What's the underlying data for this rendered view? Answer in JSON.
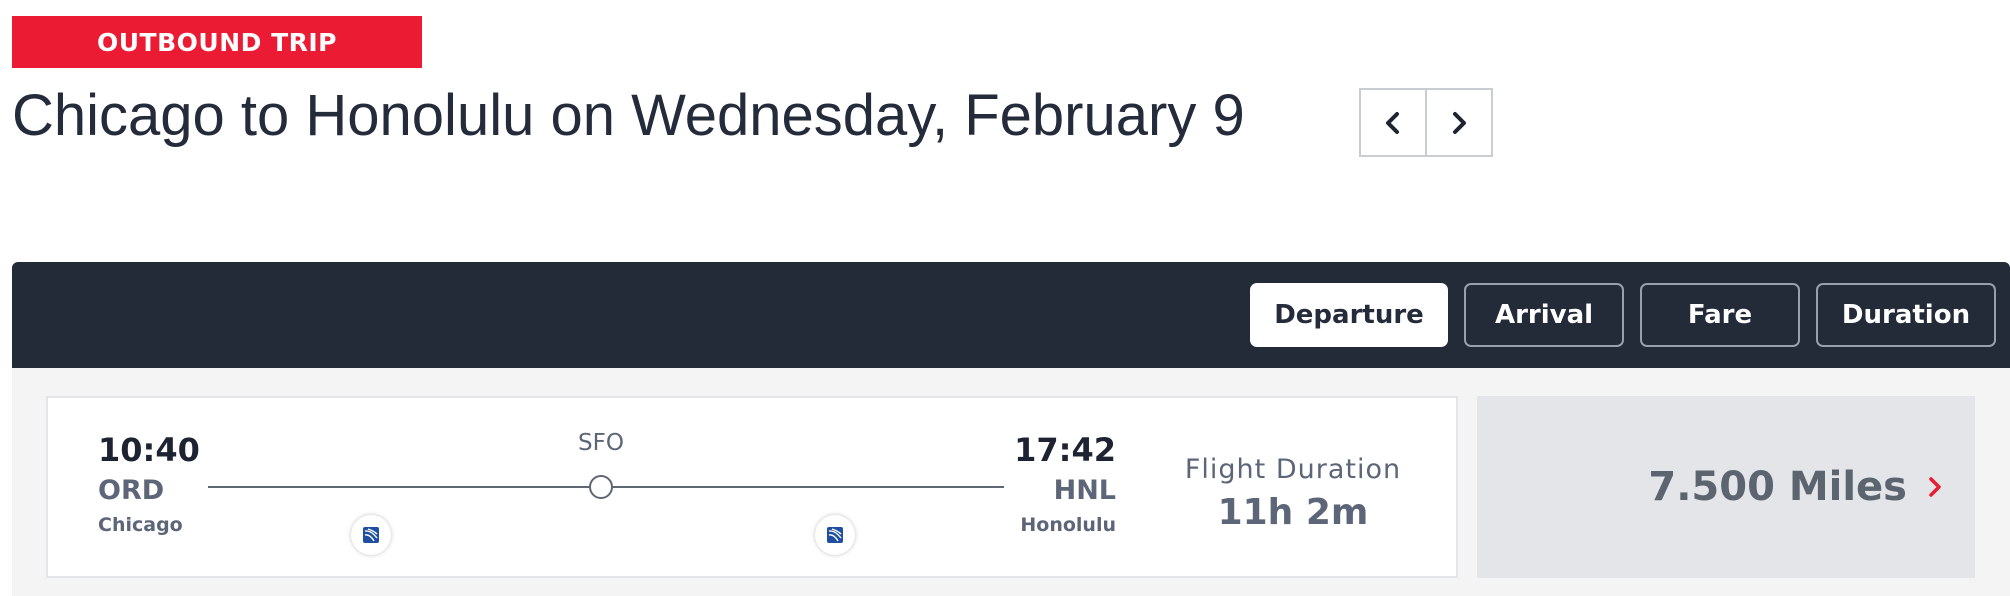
{
  "header": {
    "badge": "OUTBOUND TRIP",
    "title": "Chicago to Honolulu on Wednesday, February 9",
    "prev_icon": "chevron-left",
    "next_icon": "chevron-right"
  },
  "sort": {
    "options": [
      {
        "label": "Departure",
        "active": true
      },
      {
        "label": "Arrival",
        "active": false
      },
      {
        "label": "Fare",
        "active": false
      },
      {
        "label": "Duration",
        "active": false
      }
    ]
  },
  "flight": {
    "departure": {
      "time": "10:40",
      "code": "ORD",
      "city": "Chicago"
    },
    "stop": {
      "code": "SFO"
    },
    "arrival": {
      "time": "17:42",
      "code": "HNL",
      "city": "Honolulu"
    },
    "duration_label": "Flight Duration",
    "duration_value": "11h 2m",
    "airline_icon": "airline-logo-icon"
  },
  "fare": {
    "value": "7.500 Miles",
    "icon": "chevron-right"
  },
  "colors": {
    "accent": "#ec1b34",
    "sort_bar": "#232a38",
    "text_dark": "#242b3a",
    "text_muted": "#5c6678",
    "fare_bg": "#e3e5e8"
  }
}
